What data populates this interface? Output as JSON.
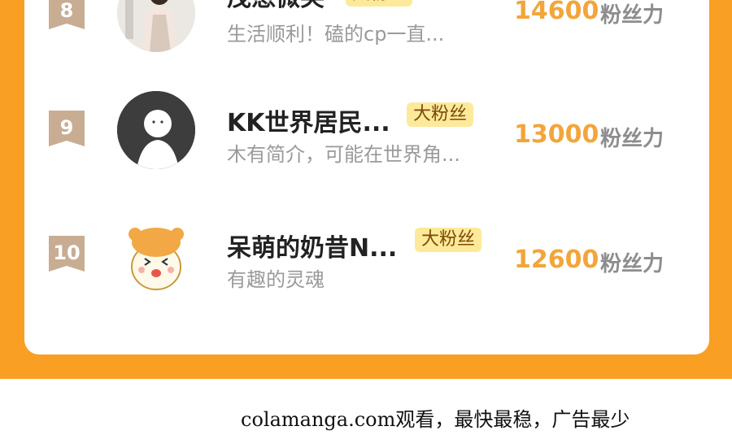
{
  "ranking": [
    {
      "rank": "8",
      "name": "茂懋微笑",
      "tag": "大粉丝",
      "bio": "生活顺利！磕的cp一直...",
      "score": "14600",
      "unit": "粉丝力"
    },
    {
      "rank": "9",
      "name": "KK世界居民...",
      "tag": "大粉丝",
      "bio": "木有简介，可能在世界角...",
      "score": "13000",
      "unit": "粉丝力"
    },
    {
      "rank": "10",
      "name": "呆萌的奶昔N...",
      "tag": "大粉丝",
      "bio": "有趣的灵魂",
      "score": "12600",
      "unit": "粉丝力"
    }
  ],
  "footer": {
    "text": "colamanga.com观看，最快最稳，广告最少"
  },
  "colors": {
    "accent": "#f99f24",
    "score": "#f3a53a",
    "tag_bg": "#fde99a"
  }
}
